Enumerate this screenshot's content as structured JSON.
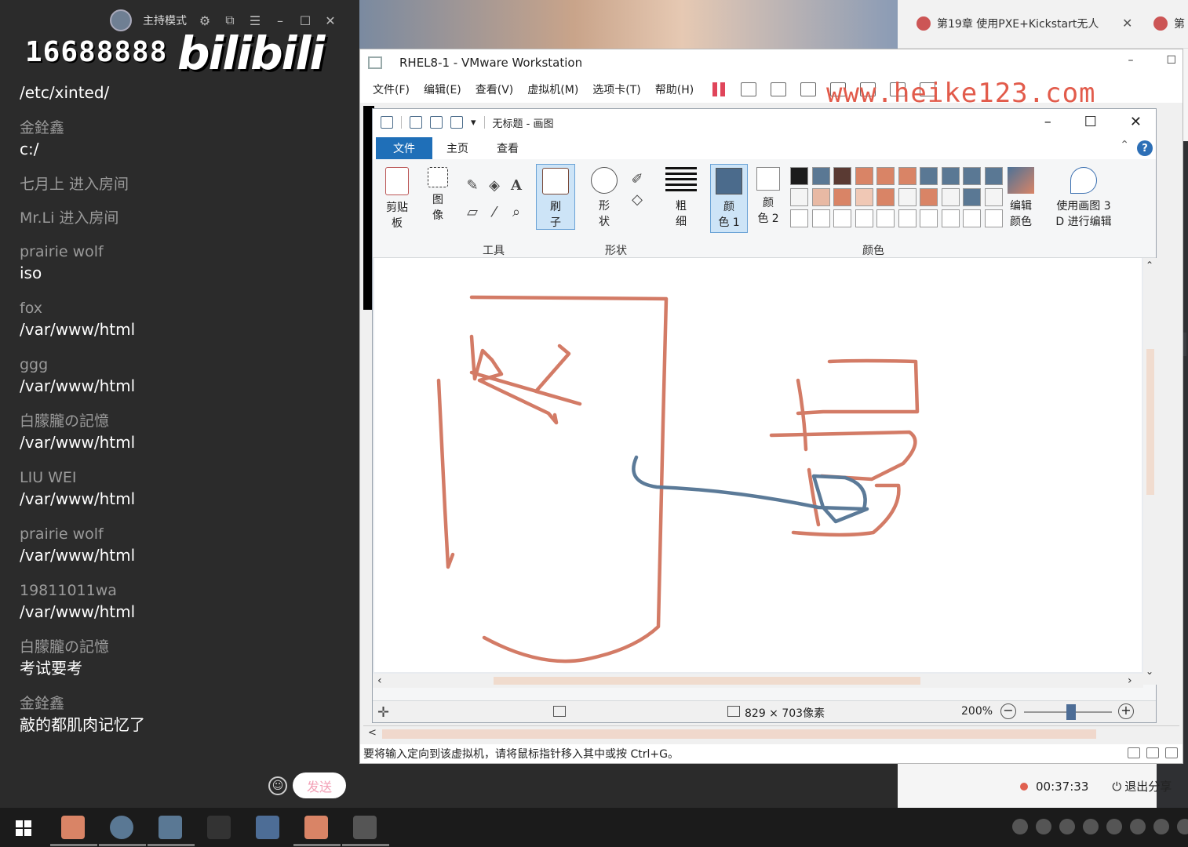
{
  "chat": {
    "header": {
      "mode_label": "主持模式"
    },
    "logo_number": "16688888",
    "logo_brand": "bilibili",
    "send_label": "发送",
    "messages": [
      {
        "user": "",
        "text": "/etc/xinted/"
      },
      {
        "user": "金銓鑫",
        "text": "c:/"
      },
      {
        "user": "七月上 进入房间",
        "text": ""
      },
      {
        "user": "Mr.Li 进入房间",
        "text": ""
      },
      {
        "user": "prairie wolf",
        "text": "iso"
      },
      {
        "user": "fox",
        "text": "/var/www/html"
      },
      {
        "user": "ggg",
        "text": "/var/www/html"
      },
      {
        "user": "白朦朧の記憶",
        "text": "/var/www/html"
      },
      {
        "user": "LIU WEI",
        "text": "/var/www/html"
      },
      {
        "user": "prairie wolf",
        "text": "/var/www/html"
      },
      {
        "user": "19811011wa",
        "text": "/var/www/html"
      },
      {
        "user": "白朦朧の記憶",
        "text": "考试要考"
      },
      {
        "user": "金銓鑫",
        "text": "敲的都肌肉记忆了"
      }
    ]
  },
  "browser": {
    "tab_title": "第19章 使用PXE+Kickstart无人",
    "tab2_title": "第"
  },
  "vmware": {
    "title": "RHEL8-1 - VMware Workstation",
    "menu": [
      "文件(F)",
      "编辑(E)",
      "查看(V)",
      "虚拟机(M)",
      "选项卡(T)",
      "帮助(H)"
    ],
    "watermark": "www.heike123.com",
    "status_text": "要将输入定向到该虚拟机，请将鼠标指针移入其中或按 Ctrl+G。"
  },
  "paint": {
    "title": "无标题 - 画图",
    "tabs": {
      "file": "文件",
      "home": "主页",
      "view": "查看"
    },
    "ribbon": {
      "clipboard": [
        "剪贴",
        "板"
      ],
      "image": [
        "图",
        "像"
      ],
      "brush": [
        "刷",
        "子"
      ],
      "shapes": [
        "形",
        "状"
      ],
      "size": [
        "粗",
        "细"
      ],
      "color1": [
        "颜",
        "色 1"
      ],
      "color2": [
        "颜",
        "色 2"
      ],
      "edit_colors": [
        "编辑",
        "颜色"
      ],
      "paint3d": [
        "使用画图 3",
        "D 进行编辑"
      ],
      "group_tools": "工具",
      "group_shapes": "形状",
      "group_colors": "颜色"
    },
    "dimensions": "829 × 703像素",
    "zoom": "200%",
    "colors": {
      "row1": [
        "#1c1c1c",
        "#5a7894",
        "#5a3a33",
        "#d98466",
        "#d98466",
        "#d98466",
        "#5a7894",
        "#5a7894",
        "#5a7894",
        "#5a7894"
      ],
      "row2": [
        "#f4f4f4",
        "#e8b9a4",
        "#d98466",
        "#f0c8b5",
        "#d98466",
        "#f4f4f4",
        "#d98466",
        "#f4f4f4",
        "#5a7894",
        "#f4f4f4"
      ],
      "stroke_orange": "#d37b66",
      "stroke_blue": "#5b7a98",
      "color1": "#4b6b8c"
    }
  },
  "recording": {
    "time": "00:37:33",
    "exit_label": "退出分享"
  }
}
